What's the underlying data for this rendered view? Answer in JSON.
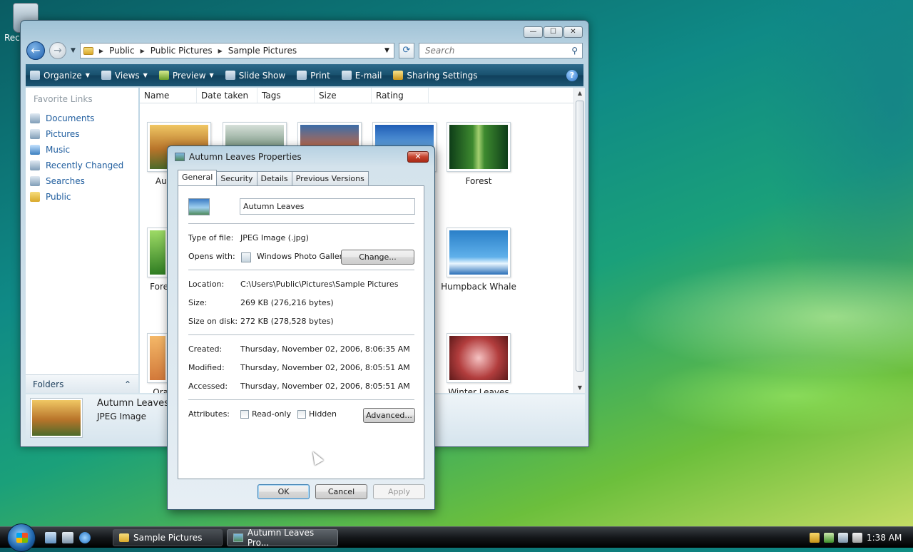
{
  "desktop": {
    "recycle_bin_label": "Rec"
  },
  "explorer": {
    "window_buttons": {
      "minimize": "—",
      "maximize": "☐",
      "close": "✕"
    },
    "breadcrumb": [
      "Public",
      "Public Pictures",
      "Sample Pictures"
    ],
    "search_placeholder": "Search",
    "toolbar": {
      "organize": "Organize",
      "views": "Views",
      "preview": "Preview",
      "slideshow": "Slide Show",
      "print": "Print",
      "email": "E-mail",
      "sharing": "Sharing Settings",
      "help": "?"
    },
    "favorites_title": "Favorite Links",
    "favorites": [
      "Documents",
      "Pictures",
      "Music",
      "Recently Changed",
      "Searches",
      "Public"
    ],
    "folders_label": "Folders",
    "columns": [
      "Name",
      "Date taken",
      "Tags",
      "Size",
      "Rating"
    ],
    "items": [
      {
        "label": "Autu",
        "image": "autumn"
      },
      {
        "label": "",
        "image": "creek"
      },
      {
        "label": "",
        "image": "desert"
      },
      {
        "label": "",
        "image": "sky"
      },
      {
        "label": "Forest",
        "image": "forest"
      },
      {
        "label": "Fore",
        "image": "green2"
      },
      {
        "label": "Humpback Whale",
        "image": "whale"
      },
      {
        "label": "Ora",
        "image": "orange2"
      },
      {
        "label": "Winter Leaves",
        "image": "winter"
      }
    ],
    "details": {
      "name": "Autumn Leaves",
      "type": "JPEG Image"
    }
  },
  "dialog": {
    "title": "Autumn Leaves Properties",
    "close": "✕",
    "tabs": [
      "General",
      "Security",
      "Details",
      "Previous Versions"
    ],
    "file_name": "Autumn Leaves",
    "type_label": "Type of file:",
    "type_value": "JPEG Image (.jpg)",
    "opens_label": "Opens with:",
    "opens_value": "Windows Photo Gallery",
    "change_button": "Change...",
    "location_label": "Location:",
    "location_value": "C:\\Users\\Public\\Pictures\\Sample Pictures",
    "size_label": "Size:",
    "size_value": "269 KB (276,216 bytes)",
    "disk_label": "Size on disk:",
    "disk_value": "272 KB (278,528 bytes)",
    "created_label": "Created:",
    "created_value": "Thursday, November 02, 2006, 8:06:35 AM",
    "modified_label": "Modified:",
    "modified_value": "Thursday, November 02, 2006, 8:05:51 AM",
    "accessed_label": "Accessed:",
    "accessed_value": "Thursday, November 02, 2006, 8:05:51 AM",
    "attributes_label": "Attributes:",
    "readonly_label": "Read-only",
    "hidden_label": "Hidden",
    "advanced_button": "Advanced...",
    "ok_button": "OK",
    "cancel_button": "Cancel",
    "apply_button": "Apply"
  },
  "taskbar": {
    "tasks": [
      "Sample Pictures",
      "Autumn Leaves Pro..."
    ],
    "clock": "1:38 AM"
  }
}
